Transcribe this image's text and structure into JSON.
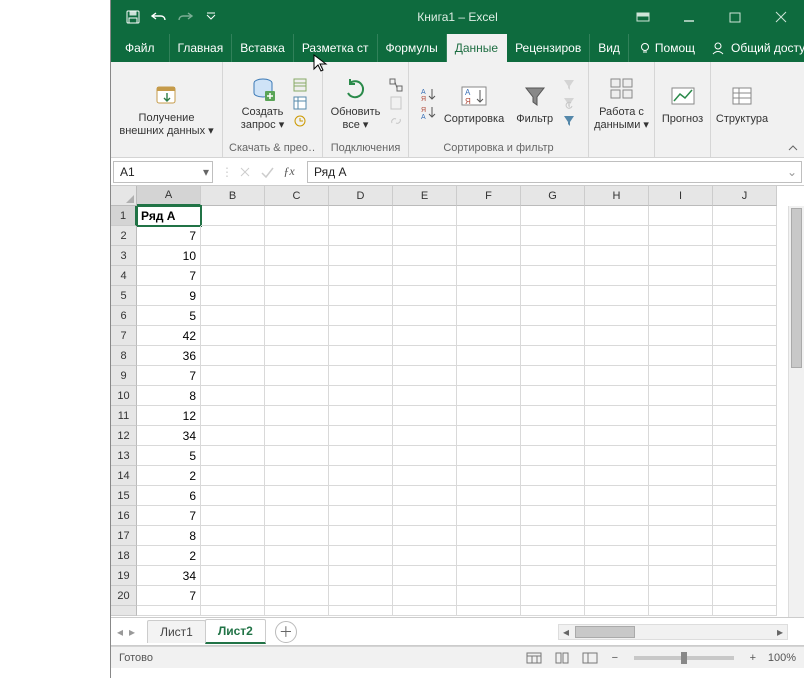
{
  "title": "Книга1 – Excel",
  "tabs": {
    "file": "Файл",
    "home": "Главная",
    "insert": "Вставка",
    "pagelayout": "Разметка ст",
    "formulas": "Формулы",
    "data": "Данные",
    "review": "Рецензиров",
    "view": "Вид",
    "help": "Помощ",
    "share": "Общий доступ"
  },
  "ribbon": {
    "getdata_label": "Получение\nвнешних данных ▾",
    "getdata_group": "",
    "query_label": "Создать\nзапрос ▾",
    "query_group": "Скачать & прео…",
    "refresh_label": "Обновить\nвсе ▾",
    "refresh_group": "Подключения",
    "sort_label": "Сортировка",
    "filter_label": "Фильтр",
    "sortfilter_group": "Сортировка и фильтр",
    "datatools_label": "Работа с\nданными ▾",
    "forecast_label": "Прогноз",
    "outline_label": "Структура"
  },
  "namebox": "A1",
  "formula": "Ряд А",
  "columns": [
    "A",
    "B",
    "C",
    "D",
    "E",
    "F",
    "G",
    "H",
    "I",
    "J"
  ],
  "rows": [
    "1",
    "2",
    "3",
    "4",
    "5",
    "6",
    "7",
    "8",
    "9",
    "10",
    "11",
    "12",
    "13",
    "14",
    "15",
    "16",
    "17",
    "18",
    "19",
    "20"
  ],
  "a1_value": "Ряд А",
  "col_a": [
    "7",
    "10",
    "7",
    "9",
    "5",
    "42",
    "36",
    "7",
    "8",
    "12",
    "34",
    "5",
    "2",
    "6",
    "7",
    "8",
    "2",
    "34",
    "7"
  ],
  "sheets": {
    "s1": "Лист1",
    "s2": "Лист2"
  },
  "status": "Готово",
  "zoom": "100%"
}
